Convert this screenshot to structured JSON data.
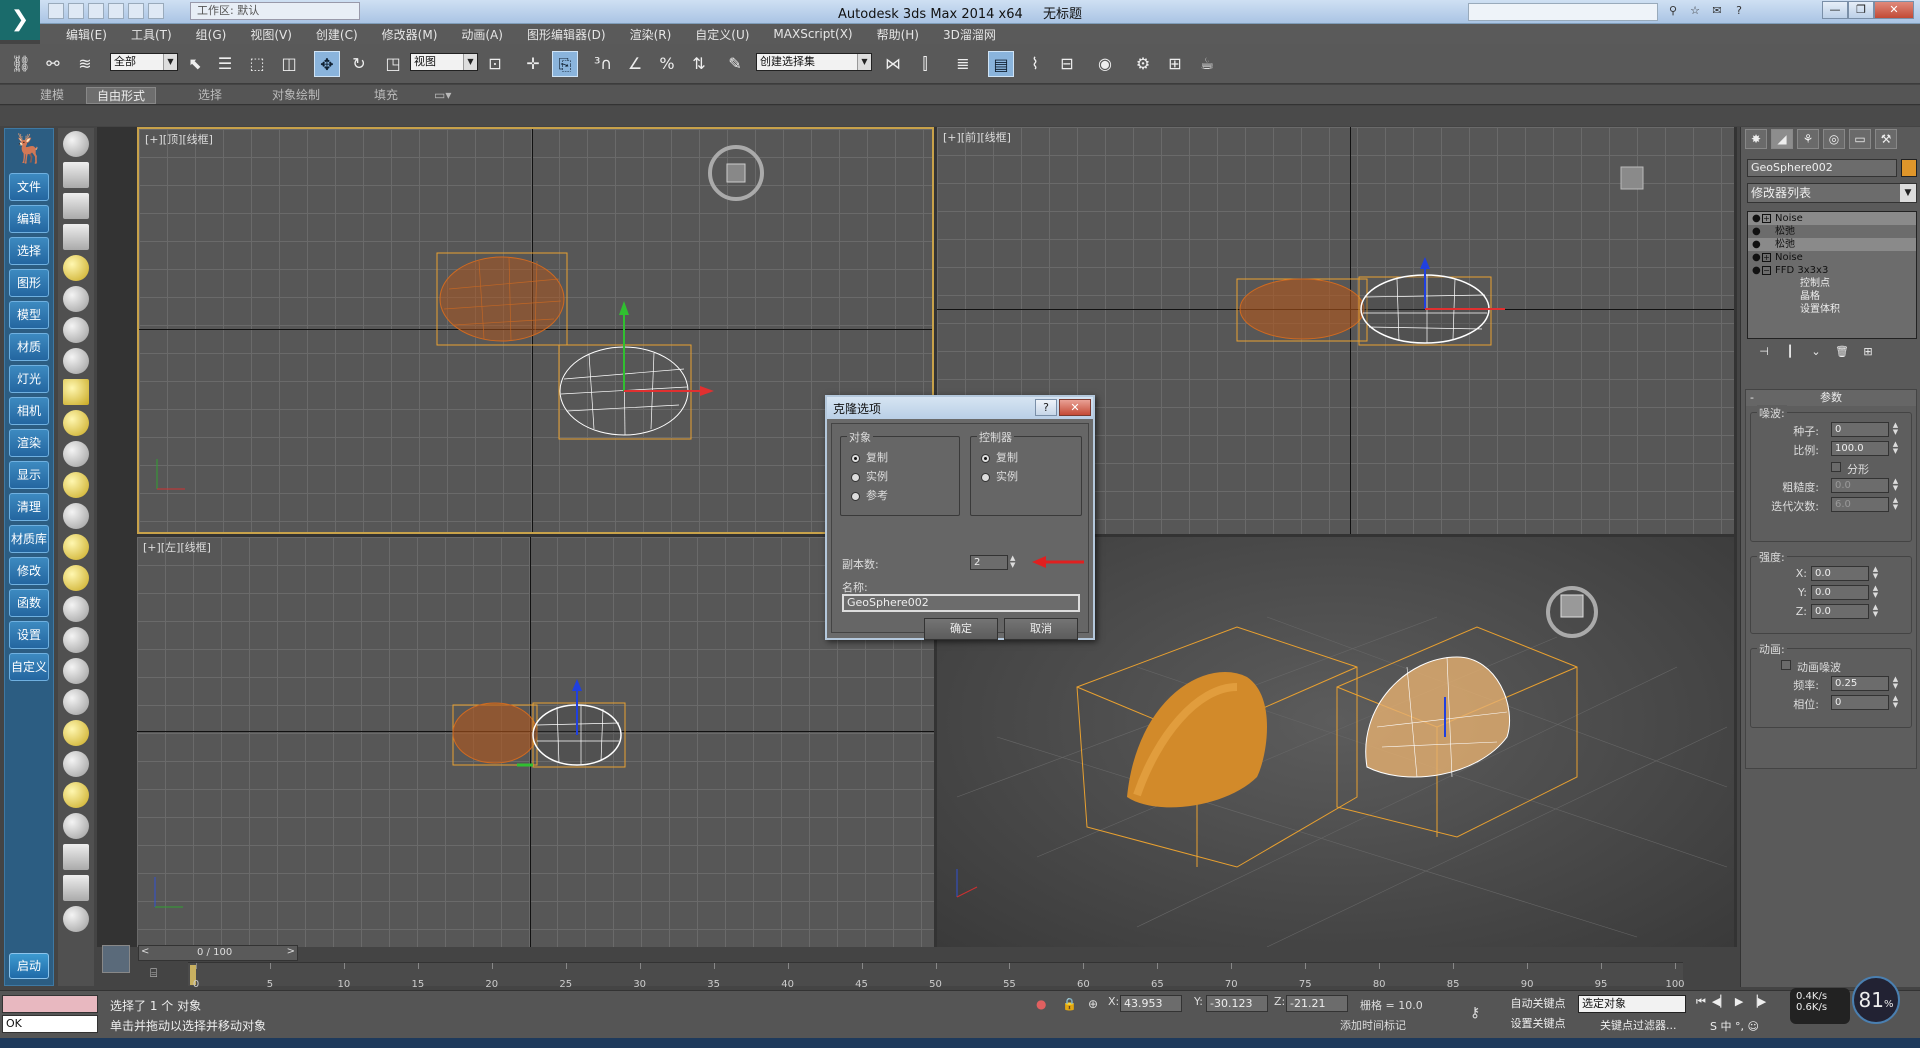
{
  "window": {
    "title": "Autodesk 3ds Max  2014 x64",
    "doc_title": "无标题",
    "workspace": "工作区: 默认",
    "controls": [
      "—",
      "❐",
      "✕"
    ]
  },
  "menu": [
    "编辑(E)",
    "工具(T)",
    "组(G)",
    "视图(V)",
    "创建(C)",
    "修改器(M)",
    "动画(A)",
    "图形编辑器(D)",
    "渲染(R)",
    "自定义(U)",
    "MAXScript(X)",
    "帮助(H)",
    "3D溜溜网"
  ],
  "toolbar": {
    "filter_select": "全部",
    "ref_coord": "视图",
    "named_selection": "创建选择集"
  },
  "ribbon": {
    "tabs": [
      "建模",
      "自由形式",
      "选择",
      "对象绘制",
      "填充"
    ]
  },
  "left_sidebar": {
    "items": [
      "文件",
      "编辑",
      "选择",
      "图形",
      "模型",
      "材质",
      "灯光",
      "相机",
      "渲染",
      "显示",
      "清理",
      "材质库",
      "修改",
      "函数",
      "设置",
      "自定义"
    ],
    "start": "启动"
  },
  "viewports": {
    "top": {
      "label": "[+][顶][线框]"
    },
    "front": {
      "label": "[+][前][线框]"
    },
    "left": {
      "label": "[+][左][线框]"
    }
  },
  "command_panel": {
    "object_name": "GeoSphere002",
    "object_color": "#e0962a",
    "modifier_list": "修改器列表",
    "stack": [
      {
        "name": "Noise",
        "selected": true,
        "box": "+"
      },
      {
        "name": "松弛",
        "selected": false,
        "box": ""
      },
      {
        "name": "松弛",
        "selected": true,
        "box": ""
      },
      {
        "name": "Noise",
        "selected": false,
        "box": "+"
      },
      {
        "name": "FFD 3x3x3",
        "selected": false,
        "box": "−"
      }
    ],
    "stack_children": [
      "控制点",
      "晶格",
      "设置体积"
    ],
    "params": {
      "rollout_title": "参数",
      "noise_group": "噪波:",
      "seed_label": "种子:",
      "seed": "0",
      "scale_label": "比例:",
      "scale": "100.0",
      "fractal_label": "分形",
      "roughness_label": "粗糙度:",
      "roughness": "0.0",
      "iterations_label": "迭代次数:",
      "iterations": "6.0",
      "strength_group": "强度:",
      "x_label": "X:",
      "x": "0.0",
      "y_label": "Y:",
      "y": "0.0",
      "z_label": "Z:",
      "z": "0.0",
      "anim_group": "动画:",
      "animate_noise_label": "动画噪波",
      "frequency_label": "频率:",
      "frequency": "0.25",
      "phase_label": "相位:",
      "phase": "0"
    }
  },
  "clone_dialog": {
    "title": "克隆选项",
    "help": "?",
    "close": "✕",
    "object_group": "对象",
    "object_options": [
      "复制",
      "实例",
      "参考"
    ],
    "object_selected": 0,
    "controller_group": "控制器",
    "controller_options": [
      "复制",
      "实例"
    ],
    "controller_selected": 0,
    "copies_label": "副本数:",
    "copies": "2",
    "name_label": "名称:",
    "name": "GeoSphere002",
    "ok": "确定",
    "cancel": "取消"
  },
  "timeline": {
    "position": "0 / 100",
    "ticks": [
      "0",
      "5",
      "10",
      "15",
      "20",
      "25",
      "30",
      "35",
      "40",
      "45",
      "50",
      "55",
      "60",
      "65",
      "70",
      "75",
      "80",
      "85",
      "90",
      "95",
      "100"
    ]
  },
  "status": {
    "maxscript_ok": "OK",
    "selection": "选择了 1 个 对象",
    "hint": "单击并拖动以选择并移动对象",
    "x_label": "X:",
    "x": "43.953",
    "y_label": "Y:",
    "y": "-30.123",
    "z_label": "Z:",
    "z": "-21.21",
    "grid": "栅格 = 10.0",
    "add_time_tag": "添加时间标记",
    "auto_key": "自动关键点",
    "set_key": "设置关键点",
    "selection_filter": "选定对象",
    "key_filters": "关键点过滤器...",
    "net_up": "0.4K/s",
    "net_down": "0.6K/s",
    "cpu": "81",
    "cpu_unit": "%"
  }
}
